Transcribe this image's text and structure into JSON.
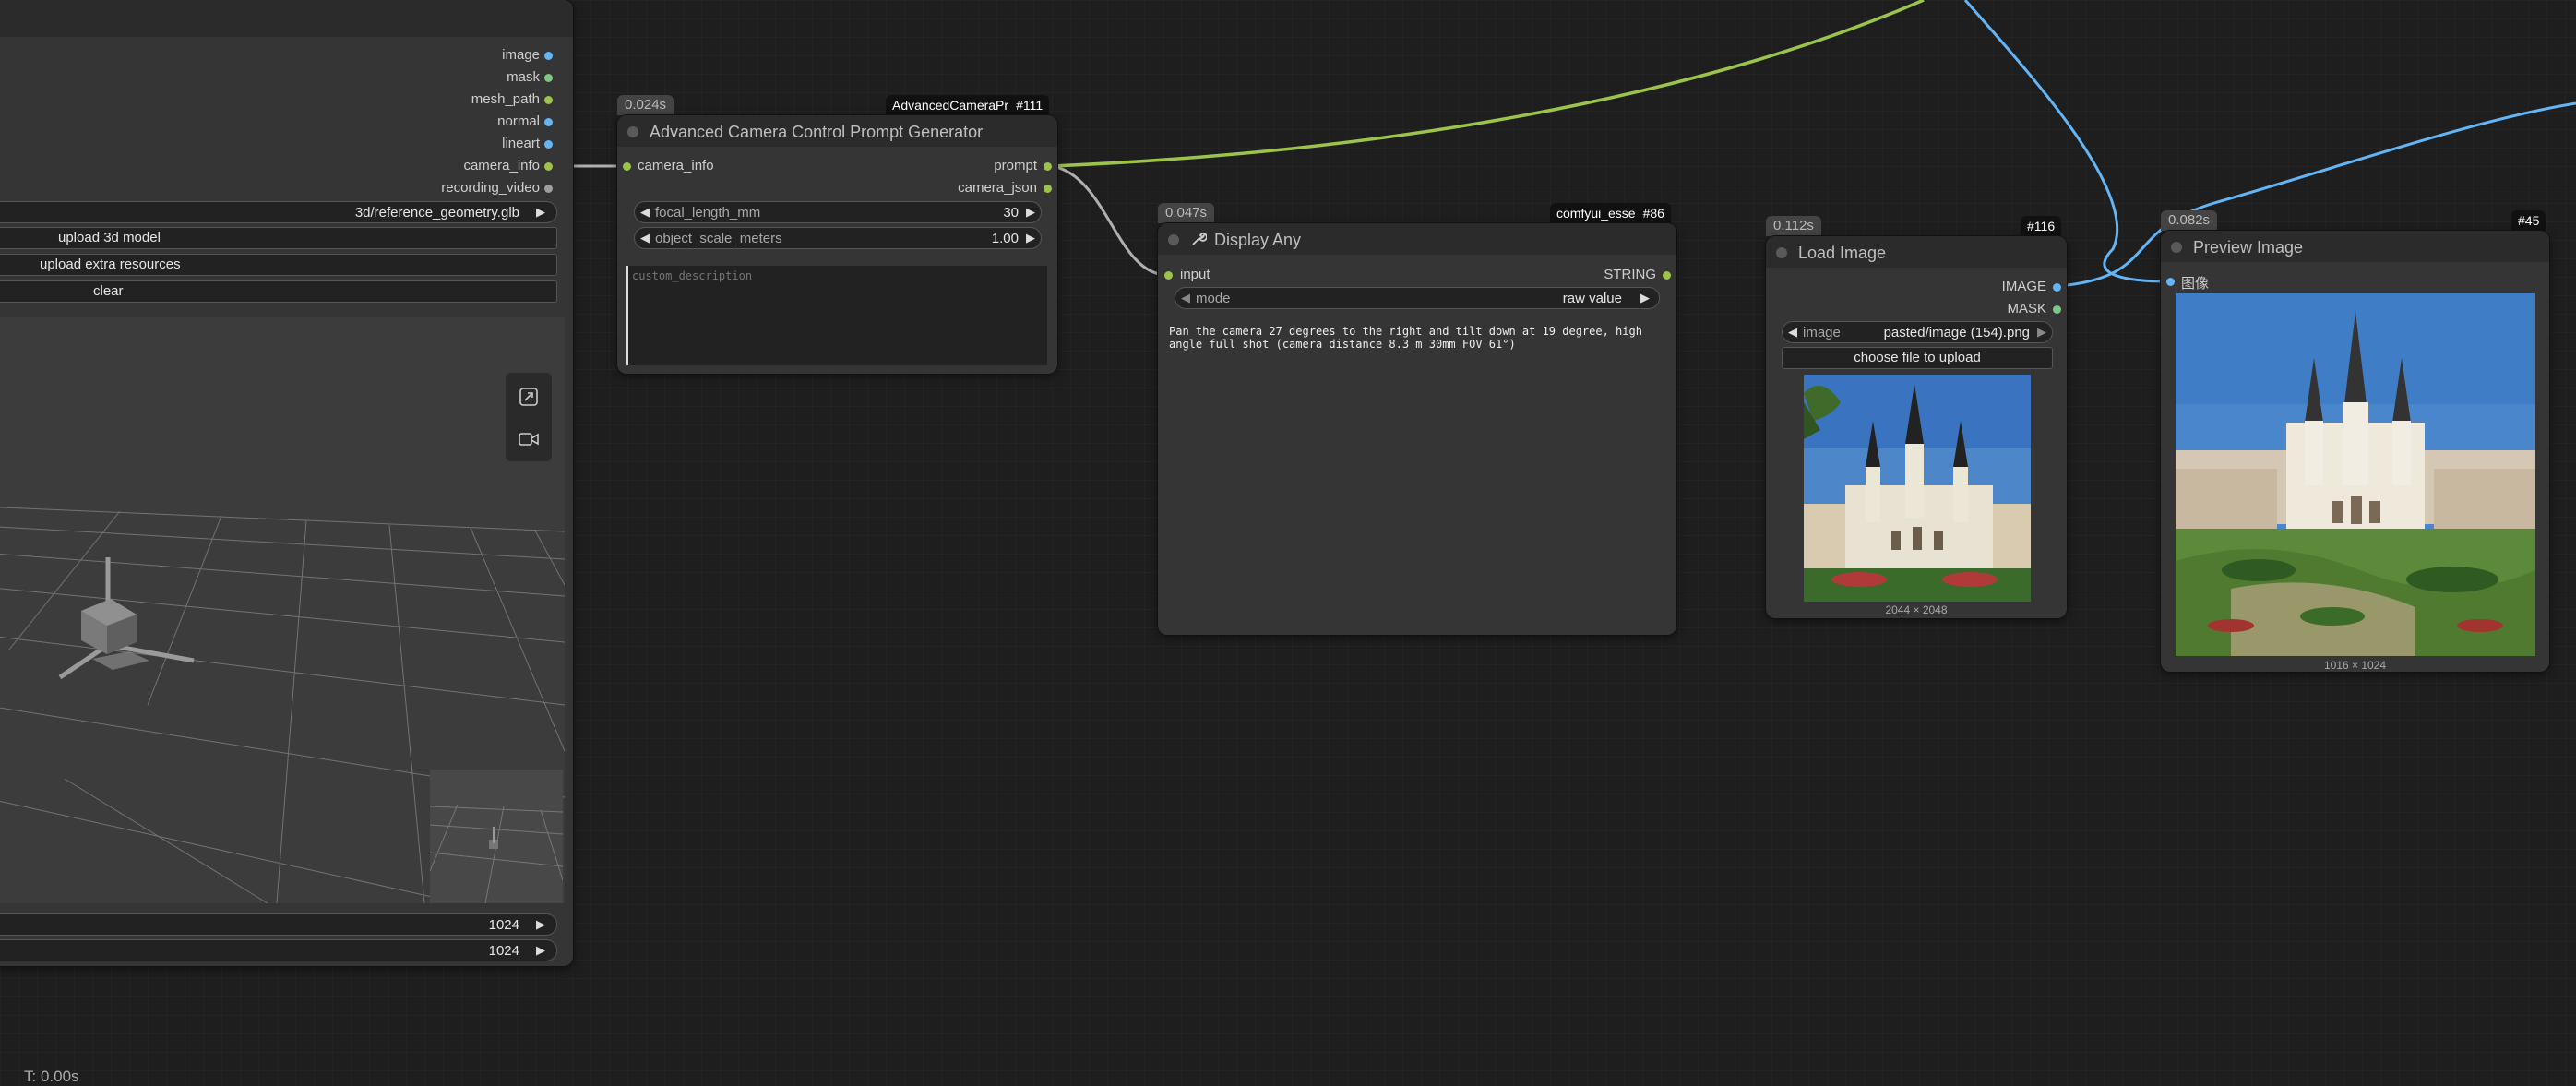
{
  "load3d": {
    "outputs": [
      "image",
      "mask",
      "mesh_path",
      "normal",
      "lineart",
      "camera_info",
      "recording_video"
    ],
    "model_file": "3d/reference_geometry.glb",
    "buttons": [
      "upload 3d model",
      "upload extra resources",
      "clear"
    ],
    "width": "1024",
    "height": "1024",
    "tools": [
      "fit-view-icon",
      "record-video-icon"
    ]
  },
  "camera_node": {
    "timing": "0.024s",
    "tag_name": "AdvancedCameraPr",
    "tag_id": "#111",
    "title": "Advanced Camera Control Prompt Generator",
    "input": "camera_info",
    "outputs": [
      "prompt",
      "camera_json"
    ],
    "focal_label": "focal_length_mm",
    "focal_value": "30",
    "scale_label": "object_scale_meters",
    "scale_value": "1.00",
    "description_placeholder": "custom_description"
  },
  "display_node": {
    "timing": "0.047s",
    "tag_name": "comfyui_esse",
    "tag_id": "#86",
    "title": "Display Any",
    "input": "input",
    "output": "STRING",
    "mode_label": "mode",
    "mode_value": "raw value",
    "text_line1": "Pan the camera 27 degrees to the right and tilt down at 19 degree, high",
    "text_line2": "angle full shot (camera distance 8.3 m 30mm FOV 61°)"
  },
  "load_image_node": {
    "timing": "0.112s",
    "tag_id": "#116",
    "title": "Load Image",
    "outputs": [
      "IMAGE",
      "MASK"
    ],
    "image_label": "image",
    "image_value": "pasted/image (154).png",
    "upload_button": "choose file to upload",
    "dimensions": "2044 × 2048"
  },
  "preview_node": {
    "timing": "0.082s",
    "tag_id": "#45",
    "title": "Preview Image",
    "input": "图像",
    "dimensions": "1016 × 1024"
  },
  "footer": {
    "timer": "T: 0.00s"
  },
  "colors": {
    "string_link": "#9cc34a",
    "image_link": "#64b5f6",
    "gray_link": "#b0b0b0",
    "canvas_bg": "#1e1e1e",
    "node_bg": "#353535"
  }
}
